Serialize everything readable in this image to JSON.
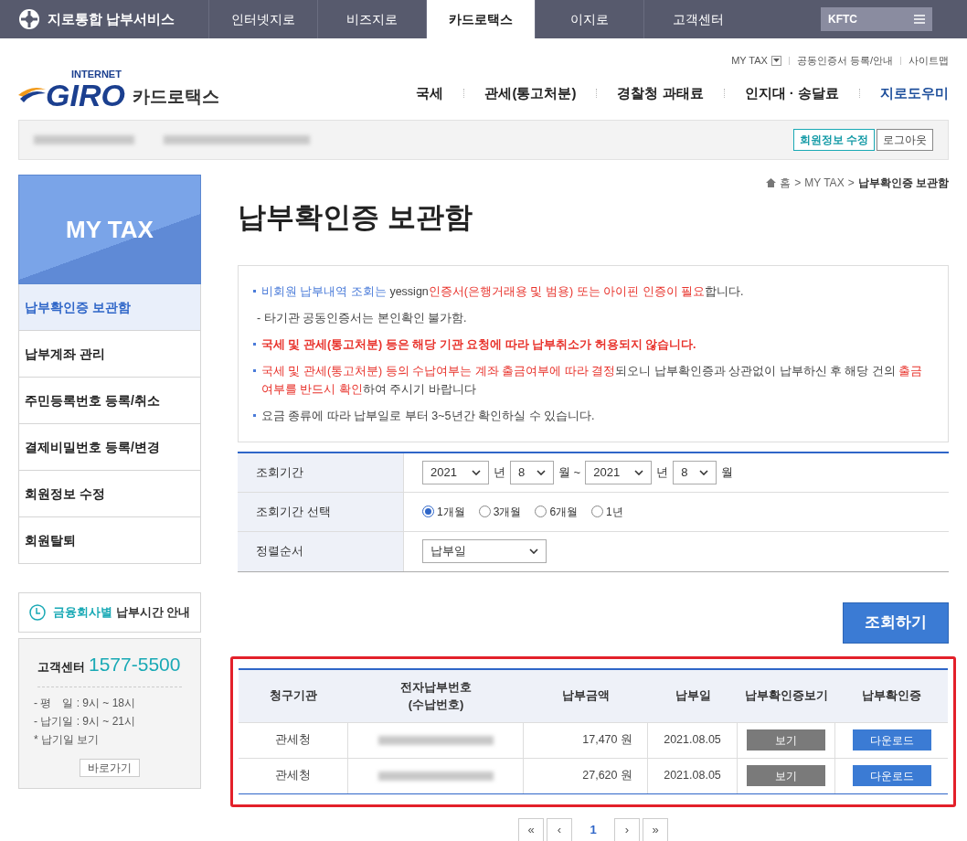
{
  "top_bar": {
    "brand": "지로통합 납부서비스",
    "tabs": [
      {
        "label": "인터넷지로",
        "selected": false
      },
      {
        "label": "비즈지로",
        "selected": false
      },
      {
        "label": "카드로택스",
        "selected": true
      },
      {
        "label": "이지로",
        "selected": false
      },
      {
        "label": "고객센터",
        "selected": false
      }
    ],
    "org_button": "KFTC"
  },
  "header": {
    "logo_small": "INTERNET",
    "logo_big": "GIRO",
    "logo_sub": "카드로택스",
    "util_links": [
      {
        "label": "MY TAX",
        "kind": "dropdown"
      },
      {
        "label": "공동인증서 등록/안내",
        "kind": "link"
      },
      {
        "label": "사이트맵",
        "kind": "link"
      }
    ],
    "menu": [
      {
        "label": "국세",
        "selected": false
      },
      {
        "label": "관세(통고처분)",
        "selected": false
      },
      {
        "label": "경찰청 과태료",
        "selected": false
      },
      {
        "label": "인지대 · 송달료",
        "selected": false
      },
      {
        "label": "지로도우미",
        "selected": true
      }
    ]
  },
  "member_bar": {
    "buttons": [
      {
        "label": "회원정보 수정",
        "kind": "primary"
      },
      {
        "label": "로그아웃",
        "kind": "plain"
      }
    ]
  },
  "sidebar": {
    "title": "MY TAX",
    "items": [
      {
        "label": "납부확인증 보관함",
        "selected": true
      },
      {
        "label": "납부계좌 관리",
        "selected": false
      },
      {
        "label": "주민등록번호 등록/취소",
        "selected": false
      },
      {
        "label": "결제비밀번호 등록/변경",
        "selected": false
      },
      {
        "label": "회원정보 수정",
        "selected": false
      },
      {
        "label": "회원탈퇴",
        "selected": false
      }
    ],
    "time_guide": {
      "highlight": "금융회사별",
      "text": "납부시간 안내"
    },
    "support": {
      "label": "고객센터",
      "phone": "1577-5500",
      "lines": [
        "- 평　일 : 9시 ~ 18시",
        "- 납기일 : 9시 ~ 21시",
        "* 납기일 보기"
      ],
      "button": "바로가기"
    }
  },
  "breadcrumb": {
    "separator": ">",
    "items": [
      "홈",
      "MY TAX",
      "납부확인증 보관함"
    ]
  },
  "page_title": "납부확인증 보관함",
  "notices": [
    {
      "bullet": true,
      "segments": [
        {
          "text": "비회원 납부내역 조회는 ",
          "kind": "blue"
        },
        {
          "text": "yessign",
          "kind": "plain"
        },
        {
          "text": "인증서(은행거래용 및 범용) 또는 아이핀 인증이 필요",
          "kind": "red"
        },
        {
          "text": "합니다.",
          "kind": "plain"
        }
      ]
    },
    {
      "bullet": false,
      "segments": [
        {
          "text": "- 타기관 공동인증서는 본인확인 불가함.",
          "kind": "plain"
        }
      ]
    },
    {
      "bullet": true,
      "segments": [
        {
          "text": "국세 및 관세(통고처분) 등은 해당 기관 요청에 따라 납부취소가 허용되지 않습니다.",
          "kind": "strong"
        }
      ]
    },
    {
      "bullet": true,
      "segments": [
        {
          "text": "국세 및 관세(통고처분) 등의 수납여부는 계좌 출금여부에 따라 결정",
          "kind": "red"
        },
        {
          "text": "되오니 납부확인증과 상관없이 납부하신 후 해당 건의 ",
          "kind": "plain"
        },
        {
          "text": "출금여부를 반드시 확인",
          "kind": "red"
        },
        {
          "text": "하여 주시기 바랍니다",
          "kind": "plain"
        }
      ]
    },
    {
      "bullet": true,
      "segments": [
        {
          "text": "요금 종류에 따라 납부일로 부터 3~5년간 확인하실 수 있습니다.",
          "kind": "plain"
        }
      ]
    }
  ],
  "search_form": {
    "period": {
      "label": "조회기간",
      "from_year": "2021",
      "year_unit": "년",
      "from_month": "8",
      "month_unit": "월 ~",
      "to_year": "2021",
      "to_year_unit": "년",
      "to_month": "8",
      "to_month_unit": "월"
    },
    "range": {
      "label": "조회기간 선택",
      "options": [
        {
          "label": "1개월",
          "selected": true
        },
        {
          "label": "3개월",
          "selected": false
        },
        {
          "label": "6개월",
          "selected": false
        },
        {
          "label": "1년",
          "selected": false
        }
      ]
    },
    "sort": {
      "label": "정렬순서",
      "value": "납부일"
    },
    "submit": "조회하기"
  },
  "table": {
    "columns": [
      "청구기관",
      "전자납부번호\n(수납번호)",
      "납부금액",
      "납부일",
      "납부확인증보기",
      "납부확인증"
    ],
    "rows": [
      {
        "agency": "관세청",
        "amount": "17,470 원",
        "date": "2021.08.05",
        "view": "보기",
        "download": "다운로드"
      },
      {
        "agency": "관세청",
        "amount": "27,620 원",
        "date": "2021.08.05",
        "view": "보기",
        "download": "다운로드"
      }
    ]
  },
  "pagination": {
    "first": "«",
    "prev": "‹",
    "pages": [
      {
        "label": "1",
        "selected": true
      }
    ],
    "next": "›",
    "last": "»"
  }
}
